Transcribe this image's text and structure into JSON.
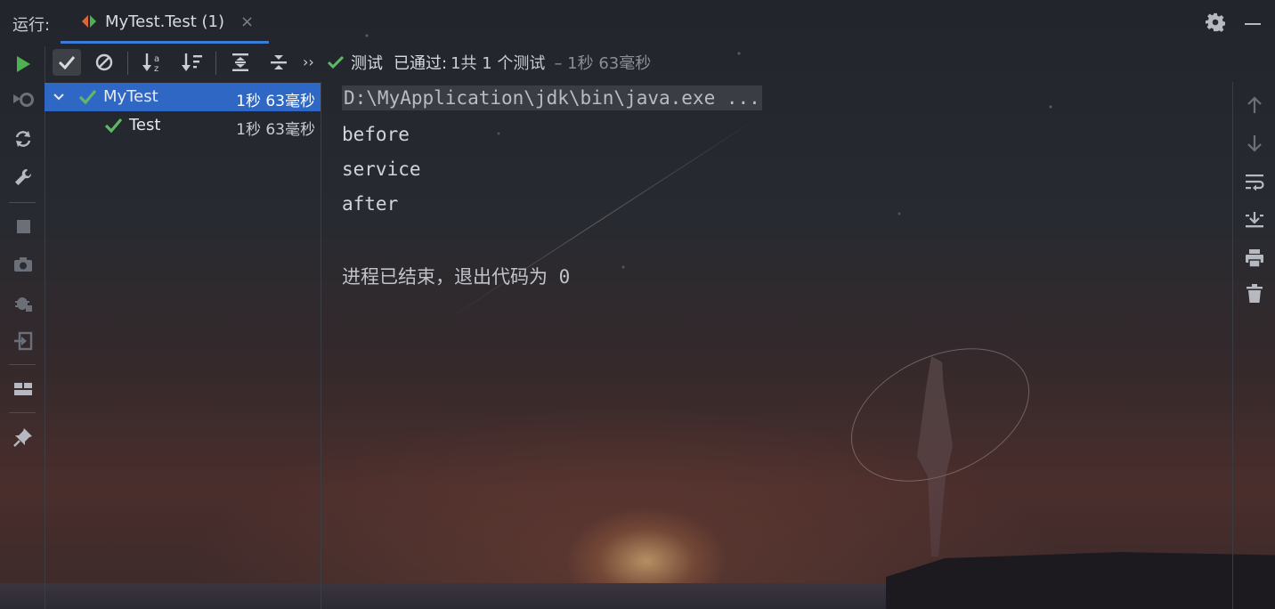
{
  "tabbar": {
    "run_label": "运行:",
    "tab_title": "MyTest.Test (1)",
    "close_symbol": "×"
  },
  "toolbar": {
    "more_symbol": "››",
    "status_prefix": "测试",
    "status_passed": "已通过:",
    "status_counts": "1共 1 个测试",
    "status_duration": "– 1秒 63毫秒"
  },
  "tree": {
    "items": [
      {
        "name": "MyTest",
        "time": "1秒 63毫秒",
        "status": "passed",
        "expanded": true,
        "selected": true
      },
      {
        "name": "Test",
        "time": "1秒 63毫秒",
        "status": "passed",
        "expanded": false,
        "selected": false
      }
    ]
  },
  "console": {
    "lines": [
      "D:\\MyApplication\\jdk\\bin\\java.exe ...",
      "before",
      "service",
      "after",
      "",
      "进程已结束，退出代码为 0"
    ]
  },
  "icons": {
    "left_toolbar": [
      "run-icon",
      "rerun-failed-icon",
      "toggle-auto-test-icon",
      "settings-wrench-icon",
      "stop-icon",
      "screenshot-camera-icon",
      "debug-exception-icon",
      "import-tests-icon",
      "layout-icon",
      "pin-icon"
    ],
    "right_toolbar": [
      "up-arrow-icon",
      "down-arrow-icon",
      "soft-wrap-icon",
      "scroll-to-end-icon",
      "print-icon",
      "trash-icon"
    ]
  },
  "colors": {
    "accent": "#3d7bd8",
    "selection": "#2f68c4",
    "pass_green": "#5fb865",
    "run_green": "#4fb04f"
  }
}
